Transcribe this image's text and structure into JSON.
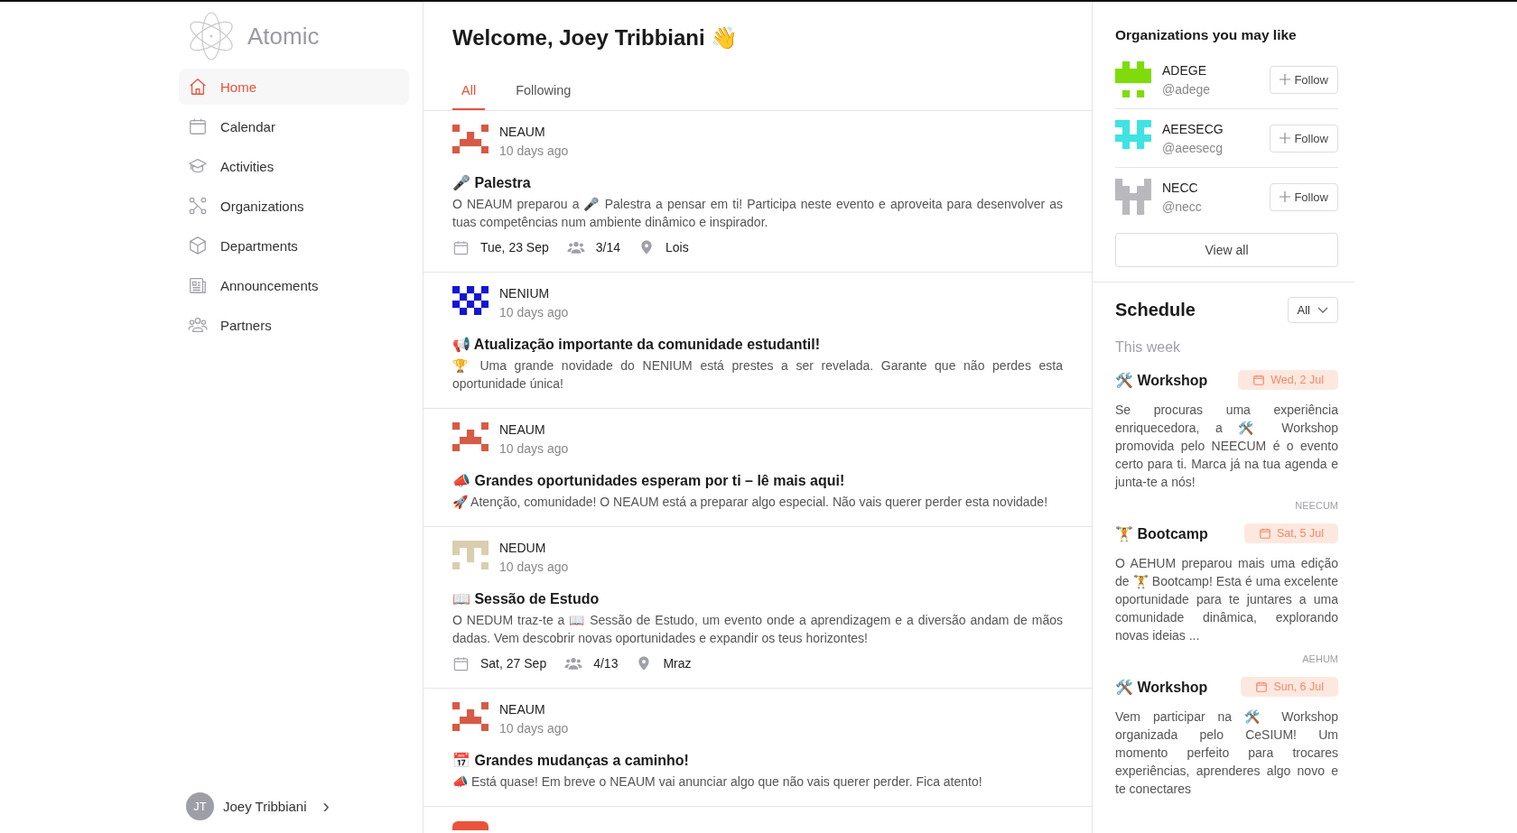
{
  "brand": {
    "name": "Atomic"
  },
  "nav": [
    {
      "label": "Home",
      "selected": true
    },
    {
      "label": "Calendar",
      "selected": false
    },
    {
      "label": "Activities",
      "selected": false
    },
    {
      "label": "Organizations",
      "selected": false
    },
    {
      "label": "Departments",
      "selected": false
    },
    {
      "label": "Announcements",
      "selected": false
    },
    {
      "label": "Partners",
      "selected": false
    }
  ],
  "user": {
    "initials": "JT",
    "name": "Joey Tribbiani",
    "chevron": "›"
  },
  "feed": {
    "title": "Welcome, Joey Tribbiani 👋",
    "tabs": [
      {
        "label": "All",
        "selected": true
      },
      {
        "label": "Following",
        "selected": false
      }
    ],
    "posts": [
      {
        "org": "NEAUM",
        "color": "#d65a45",
        "time": "10 days ago",
        "title": "🎤 Palestra",
        "body": "O NEAUM preparou a 🎤 Palestra a pensar em ti! Participa neste evento e aproveita para desenvolver as tuas competências num ambiente dinâmico e inspirador.",
        "date": "Tue, 23 Sep",
        "capacity": "3/14",
        "location": "Lois"
      },
      {
        "org": "NENIUM",
        "color": "#1414d6",
        "time": "10 days ago",
        "title": "📢 Atualização importante da comunidade estudantil!",
        "body": "🏆 Uma grande novidade do NENIUM está prestes a ser revelada. Garante que não perdes esta oportunidade única!"
      },
      {
        "org": "NEAUM",
        "color": "#d65a45",
        "time": "10 days ago",
        "title": "📣 Grandes oportunidades esperam por ti – lê mais aqui!",
        "body": "🚀 Atenção, comunidade! O NEAUM está a preparar algo especial. Não vais querer perder esta novidade!"
      },
      {
        "org": "NEDUM",
        "color": "#d9ceb0",
        "time": "10 days ago",
        "title": "📖 Sessão de Estudo",
        "body": "O NEDUM traz-te a 📖 Sessão de Estudo, um evento onde a aprendizagem e a diversão andam de mãos dadas. Vem descobrir novas oportunidades e expandir os teus horizontes!",
        "date": "Sat, 27 Sep",
        "capacity": "4/13",
        "location": "Mraz"
      },
      {
        "org": "NEAUM",
        "color": "#d65a45",
        "time": "10 days ago",
        "title": "📅 Grandes mudanças a caminho!",
        "body": "📣 Está quase! Em breve o NEAUM vai anunciar algo que não vais querer perder. Fica atento!"
      }
    ],
    "cut_posts": [
      {
        "color": "#e8533a"
      }
    ]
  },
  "suggestions": {
    "title": "Organizations you may like",
    "orgs": [
      {
        "name": "ADEGE",
        "handle": "@adege",
        "color": "#7fdc0a",
        "button": "Follow"
      },
      {
        "name": "AEESECG",
        "handle": "@aeesecg",
        "color": "#3fe3e3",
        "button": "Follow"
      },
      {
        "name": "NECC",
        "handle": "@necc",
        "color": "#b9b9bd",
        "button": "Follow"
      }
    ],
    "view_all": "View all"
  },
  "schedule": {
    "title": "Schedule",
    "filter": "All",
    "section": "This week",
    "events": [
      {
        "title": "🛠️ Workshop",
        "date": "Wed, 2 Jul",
        "body": "Se procuras uma experiência enriquecedora, a 🛠️ Workshop promovida pelo NEECUM é o evento certo para ti. Marca já na tua agenda e junta-te a nós!",
        "org": "NEECUM"
      },
      {
        "title": "🏋️ Bootcamp",
        "date": "Sat, 5 Jul",
        "body": "O AEHUM preparou mais uma edição de 🏋️ Bootcamp! Esta é uma excelente oportunidade para te juntares a uma comunidade dinâmica, explorando novas ideias ...",
        "org": "AEHUM"
      },
      {
        "title": "🛠️ Workshop",
        "date": "Sun, 6 Jul",
        "body": "Vem participar na 🛠️ Workshop organizada pelo CeSIUM! Um momento perfeito para trocares experiências, aprenderes algo novo e te conectares"
      }
    ]
  }
}
